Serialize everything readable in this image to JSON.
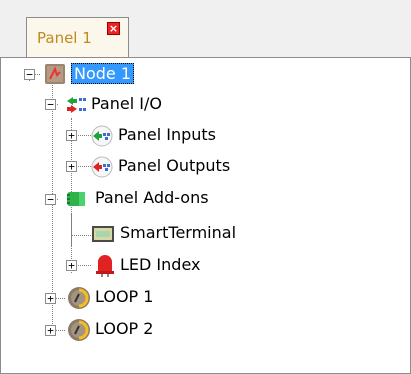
{
  "tab": {
    "label": "Panel 1"
  },
  "tree": {
    "node": "Node 1",
    "panel_io": "Panel I/O",
    "panel_inputs": "Panel Inputs",
    "panel_outputs": "Panel Outputs",
    "panel_addons": "Panel Add-ons",
    "smart_terminal": "SmartTerminal",
    "led_index": "LED Index",
    "loop1": "LOOP 1",
    "loop2": "LOOP 2"
  },
  "icons": {
    "node": "node-icon",
    "panel_io": "io-icon",
    "panel_inputs": "input-icon",
    "panel_outputs": "output-icon",
    "panel_addons": "addon-icon",
    "smart_terminal": "terminal-icon",
    "led_index": "led-icon",
    "loop": "loop-icon"
  },
  "colors": {
    "selection": "#3399ff",
    "tab_text": "#c28a1e"
  }
}
